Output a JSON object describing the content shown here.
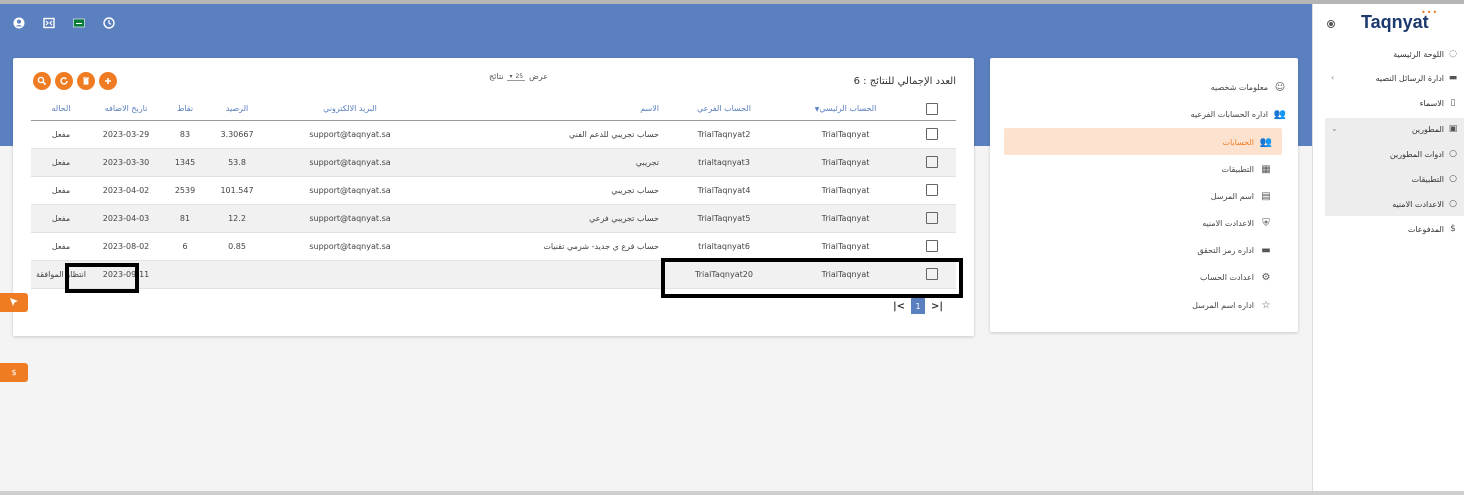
{
  "top_icons": [
    "user-circle-icon",
    "fullscreen-icon",
    "flag-icon",
    "clock-icon"
  ],
  "header": {
    "total_label": "العدد الإجمالي للنتائج : 6",
    "show_label": "عرض",
    "show_value": "25",
    "results_label": "نتائج"
  },
  "toolbar": {
    "buttons": [
      "search-icon",
      "refresh-icon",
      "delete-icon",
      "add-icon"
    ]
  },
  "table": {
    "headers": {
      "main_account": "الحساب الرئيسي",
      "sub_account": "الحساب الفرعي",
      "name": "الاسم",
      "email": "البريد الالكتروني",
      "balance": "الرصيد",
      "points": "نقاط",
      "added_date": "تاريخ الاضافه",
      "status": "الحاله"
    },
    "rows": [
      {
        "main": "TrialTaqnyat",
        "sub": "TrialTaqnyat2",
        "name": "حساب تجريبي للدعم الفني",
        "email": "support@taqnyat.sa",
        "balance": "3.30667",
        "points": "83",
        "date": "2023-03-29",
        "status": "مفعل"
      },
      {
        "main": "TrialTaqnyat",
        "sub": "trialtaqnyat3",
        "name": "تجريبي",
        "email": "support@taqnyat.sa",
        "balance": "53.8",
        "points": "1345",
        "date": "2023-03-30",
        "status": "مفعل"
      },
      {
        "main": "TrialTaqnyat",
        "sub": "TrialTaqnyat4",
        "name": "حساب تجريبي",
        "email": "support@taqnyat.sa",
        "balance": "101.547",
        "points": "2539",
        "date": "2023-04-02",
        "status": "مفعل"
      },
      {
        "main": "TrialTaqnyat",
        "sub": "TrialTaqnyat5",
        "name": "حساب تجريبي فرعي",
        "email": "support@taqnyat.sa",
        "balance": "12.2",
        "points": "81",
        "date": "2023-04-03",
        "status": "مفعل"
      },
      {
        "main": "TrialTaqnyat",
        "sub": "trialtaqnyat6",
        "name": "حساب فرع ي جديد- شرمي تقنيات",
        "email": "support@taqnyat.sa",
        "balance": "0.85",
        "points": "6",
        "date": "2023-08-02",
        "status": "مفعل"
      },
      {
        "main": "TrialTaqnyat",
        "sub": "TrialTaqnyat20",
        "name": "",
        "email": "",
        "balance": "",
        "points": "",
        "date": "2023-09-11",
        "status": "انتظار الموافقة"
      }
    ]
  },
  "pagination": {
    "current": "1"
  },
  "account_menu": {
    "items": [
      {
        "label": "معلومات شخصيه",
        "icon": "smiley-icon"
      },
      {
        "label": "اداره الحسابات الفرعيه",
        "icon": "group-icon"
      },
      {
        "label": "الحسابات",
        "icon": "accounts-icon"
      },
      {
        "label": "التطبيقات",
        "icon": "apps-grid-icon"
      },
      {
        "label": "اسم المرسل",
        "icon": "id-card-icon"
      },
      {
        "label": "الاعدادت الامنيه",
        "icon": "shield-icon"
      },
      {
        "label": "اداره رمز التحقق",
        "icon": "chat-icon"
      },
      {
        "label": "اعدادت الحساب",
        "icon": "gear-icon"
      },
      {
        "label": "اداره اسم المرسل",
        "icon": "star-icon"
      }
    ]
  },
  "sidebar": {
    "logo": "Taqnyat",
    "items": [
      {
        "label": "اللوحة الرئيسية",
        "icon": "palette-icon"
      },
      {
        "label": "ادارة الرسائل النصيه",
        "icon": "message-icon"
      },
      {
        "label": "الاسماء",
        "icon": "book-icon"
      },
      {
        "label": "المطورين",
        "icon": "code-icon"
      },
      {
        "label": "ادوات المطورين",
        "icon": "dot-icon"
      },
      {
        "label": "التطبيقات",
        "icon": "dot-icon"
      },
      {
        "label": "الاعدادت الامنيه",
        "icon": "dot-icon"
      },
      {
        "label": "المدفوعات",
        "icon": "dollar-icon"
      }
    ]
  },
  "float_buttons": {
    "dollar": "$"
  },
  "colors": {
    "accent": "#ef7c23",
    "primary": "#5b80bf",
    "highlight": "#fde3cf"
  }
}
